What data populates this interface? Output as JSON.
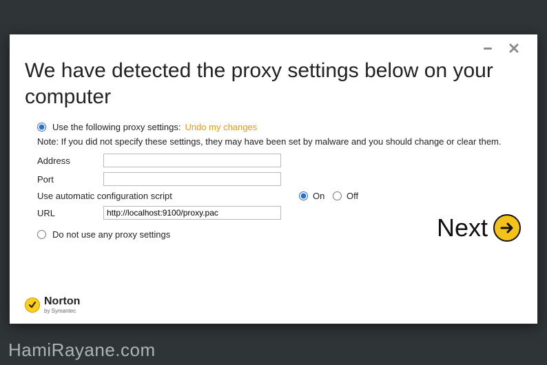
{
  "heading": "We have detected the proxy settings below on your computer",
  "radio_use": {
    "label": "Use the following proxy settings:",
    "undo_link": "Undo my changes",
    "checked": true
  },
  "note": "Note: If you did not specify these settings, they may have been set by malware and you should change or clear them.",
  "fields": {
    "address": {
      "label": "Address",
      "value": ""
    },
    "port": {
      "label": "Port",
      "value": ""
    },
    "script": {
      "label": "Use automatic configuration script",
      "on_label": "On",
      "off_label": "Off",
      "selected": "on"
    },
    "url": {
      "label": "URL",
      "value": "http://localhost:9100/proxy.pac"
    }
  },
  "radio_none": {
    "label": "Do not use any proxy settings",
    "checked": false
  },
  "next_label": "Next",
  "brand": {
    "name": "Norton",
    "sub": "by Symantec"
  },
  "watermark": "HamiRayane.com"
}
